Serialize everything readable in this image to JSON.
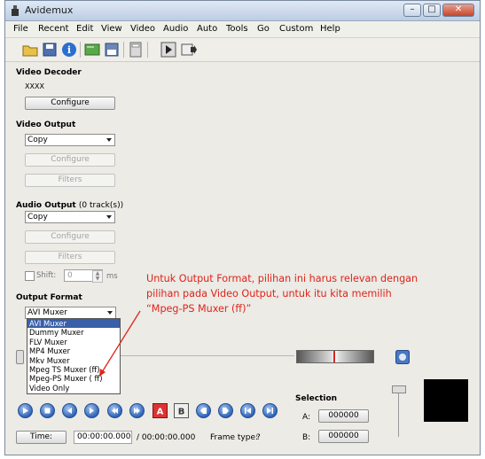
{
  "window": {
    "title": "Avidemux"
  },
  "menu": [
    "File",
    "Recent",
    "Edit",
    "View",
    "Video",
    "Audio",
    "Auto",
    "Tools",
    "Go",
    "Custom",
    "Help"
  ],
  "video_decoder": {
    "heading": "Video Decoder",
    "codec": "XXXX",
    "configure": "Configure"
  },
  "video_output": {
    "heading": "Video Output",
    "selected": "Copy",
    "configure": "Configure",
    "filters": "Filters"
  },
  "audio_output": {
    "heading": "Audio Output",
    "tracks": "(0 track(s))",
    "selected": "Copy",
    "configure": "Configure",
    "filters": "Filters",
    "shift_label": "Shift:",
    "shift_value": "0",
    "shift_unit": "ms"
  },
  "output_format": {
    "heading": "Output Format",
    "selected": "AVI Muxer",
    "options": [
      "AVI Muxer",
      "Dummy Muxer",
      "FLV Muxer",
      "MP4 Muxer",
      "Mkv Muxer",
      "Mpeg TS Muxer (ff)",
      "Mpeg-PS Muxer ( ff)",
      "Video Only"
    ]
  },
  "annotation": {
    "line1": "Untuk Output Format, pilihan ini harus relevan dengan",
    "line2": "pilihan pada Video Output, untuk itu kita memilih",
    "line3": "“Mpeg-PS Muxer (ff)”"
  },
  "selection": {
    "heading": "Selection",
    "a_label": "A:",
    "a_value": "000000",
    "b_label": "B:",
    "b_value": "000000"
  },
  "time": {
    "button": "Time:",
    "current": "00:00:00.000",
    "total": "/ 00:00:00.000",
    "frame_type_label": "Frame type:",
    "frame_type_value": "?"
  },
  "colors": {
    "annotation": "#e0231a",
    "selection_highlight": "#3a5fa8",
    "preview": "#000000"
  }
}
